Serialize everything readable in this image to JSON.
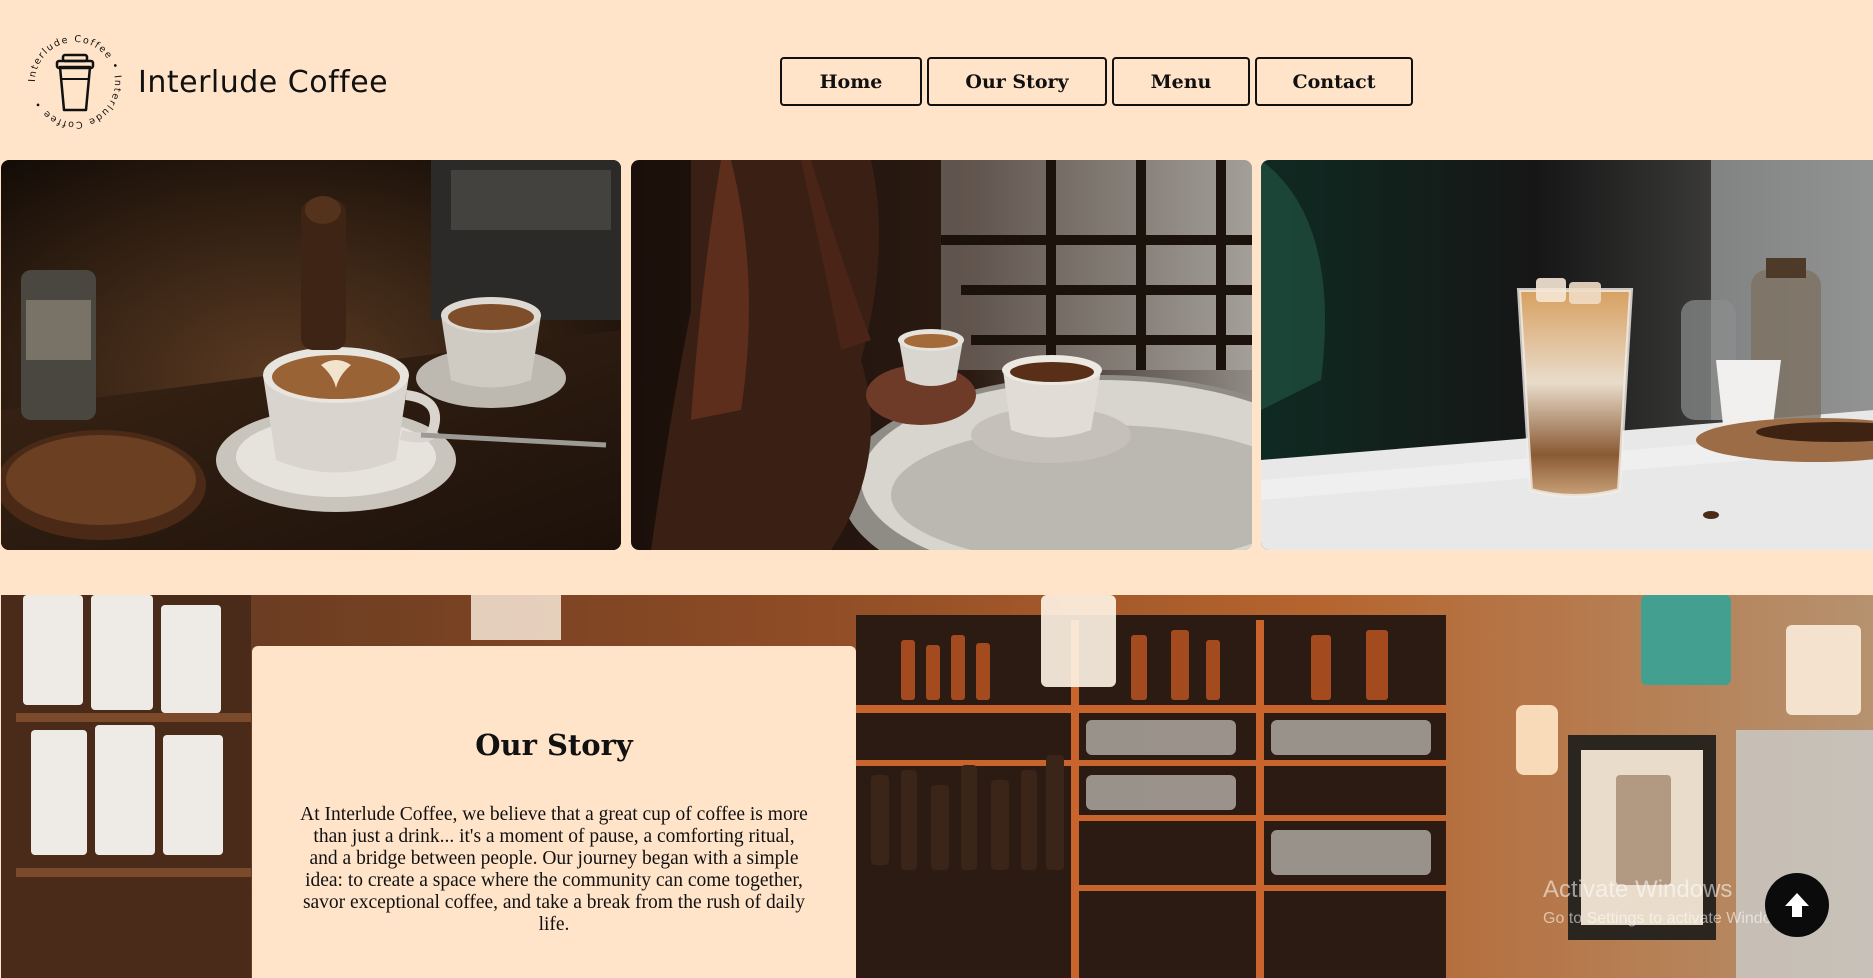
{
  "brand": {
    "name": "Interlude Coffee",
    "ring_text": "Interlude Coffee • Interlude Coffee •"
  },
  "nav": {
    "items": [
      {
        "label": "Home"
      },
      {
        "label": "Our Story"
      },
      {
        "label": "Menu"
      },
      {
        "label": "Contact"
      }
    ]
  },
  "gallery": {
    "images": [
      {
        "subject": "latte art cups on dark wooden table with coffee beans"
      },
      {
        "subject": "woman holding cup by sunlit window"
      },
      {
        "subject": "iced coffee glass on white marble table"
      }
    ]
  },
  "story": {
    "title": "Our Story",
    "text": "At Interlude Coffee, we believe that a great cup of coffee is more than just a drink... it's a moment of pause, a comforting ritual, and a bridge between people. Our journey began with a simple idea: to create a space where the community can come together, savor exceptional coffee, and take a break from the rush of daily life."
  },
  "os_watermark": {
    "title": "Activate Windows",
    "subtitle": "Go to Settings to activate Windows."
  },
  "colors": {
    "background": "#ffe4c9",
    "text": "#111111",
    "button_border": "#111111"
  },
  "icons": {
    "logo": "coffee-cup-icon",
    "scroll_top": "arrow-up-icon"
  }
}
